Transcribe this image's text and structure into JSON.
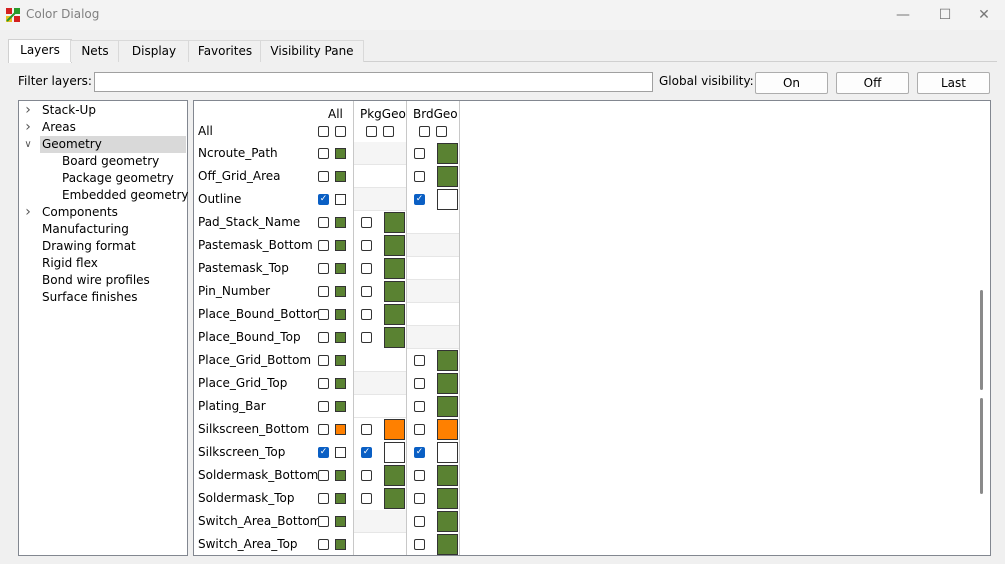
{
  "window": {
    "title": "Color Dialog"
  },
  "tabs": [
    "Layers",
    "Nets",
    "Display",
    "Favorites",
    "Visibility Pane"
  ],
  "filter": {
    "label": "Filter layers:",
    "value": ""
  },
  "global_visibility": {
    "label": "Global visibility:",
    "on": "On",
    "off": "Off",
    "last": "Last"
  },
  "tree": [
    {
      "label": "Stack-Up",
      "level": 0,
      "expander": "collapsed"
    },
    {
      "label": "Areas",
      "level": 0,
      "expander": "collapsed"
    },
    {
      "label": "Geometry",
      "level": 0,
      "expander": "expanded",
      "selected": true
    },
    {
      "label": "Board geometry",
      "level": 1
    },
    {
      "label": "Package geometry",
      "level": 1
    },
    {
      "label": "Embedded geometry",
      "level": 1
    },
    {
      "label": "Components",
      "level": 0,
      "expander": "collapsed"
    },
    {
      "label": "Manufacturing",
      "level": 0
    },
    {
      "label": "Drawing format",
      "level": 0
    },
    {
      "label": "Rigid flex",
      "level": 0
    },
    {
      "label": "Bond wire profiles",
      "level": 0
    },
    {
      "label": "Surface finishes",
      "level": 0
    }
  ],
  "grid": {
    "col_all": "All",
    "col_pkg": "PkgGeo",
    "col_brd": "BrdGeo",
    "row_all": "All",
    "colors": {
      "green": "#5a8232",
      "orange": "#ff8000",
      "white": "#ffffff"
    },
    "rows": [
      {
        "name": "Ncroute_Path",
        "all_on": false,
        "all_color": "green",
        "pkg": null,
        "brd": {
          "on": false,
          "color": "green"
        }
      },
      {
        "name": "Off_Grid_Area",
        "all_on": false,
        "all_color": "green",
        "pkg": null,
        "brd": {
          "on": false,
          "color": "green"
        }
      },
      {
        "name": "Outline",
        "all_on": true,
        "all_color": "white",
        "pkg": null,
        "brd": {
          "on": true,
          "color": "white"
        }
      },
      {
        "name": "Pad_Stack_Name",
        "all_on": false,
        "all_color": "green",
        "pkg": {
          "on": false,
          "color": "green"
        },
        "brd": null
      },
      {
        "name": "Pastemask_Bottom",
        "all_on": false,
        "all_color": "green",
        "pkg": {
          "on": false,
          "color": "green"
        },
        "brd": null
      },
      {
        "name": "Pastemask_Top",
        "all_on": false,
        "all_color": "green",
        "pkg": {
          "on": false,
          "color": "green"
        },
        "brd": null
      },
      {
        "name": "Pin_Number",
        "all_on": false,
        "all_color": "green",
        "pkg": {
          "on": false,
          "color": "green"
        },
        "brd": null
      },
      {
        "name": "Place_Bound_Bottom",
        "all_on": false,
        "all_color": "green",
        "pkg": {
          "on": false,
          "color": "green"
        },
        "brd": null
      },
      {
        "name": "Place_Bound_Top",
        "all_on": false,
        "all_color": "green",
        "pkg": {
          "on": false,
          "color": "green"
        },
        "brd": null
      },
      {
        "name": "Place_Grid_Bottom",
        "all_on": false,
        "all_color": "green",
        "pkg": null,
        "brd": {
          "on": false,
          "color": "green"
        }
      },
      {
        "name": "Place_Grid_Top",
        "all_on": false,
        "all_color": "green",
        "pkg": null,
        "brd": {
          "on": false,
          "color": "green"
        }
      },
      {
        "name": "Plating_Bar",
        "all_on": false,
        "all_color": "green",
        "pkg": null,
        "brd": {
          "on": false,
          "color": "green"
        }
      },
      {
        "name": "Silkscreen_Bottom",
        "all_on": false,
        "all_color": "orange",
        "pkg": {
          "on": false,
          "color": "orange"
        },
        "brd": {
          "on": false,
          "color": "orange"
        }
      },
      {
        "name": "Silkscreen_Top",
        "all_on": true,
        "all_color": "white",
        "pkg": {
          "on": true,
          "color": "white"
        },
        "brd": {
          "on": true,
          "color": "white"
        }
      },
      {
        "name": "Soldermask_Bottom",
        "all_on": false,
        "all_color": "green",
        "pkg": {
          "on": false,
          "color": "green"
        },
        "brd": {
          "on": false,
          "color": "green"
        }
      },
      {
        "name": "Soldermask_Top",
        "all_on": false,
        "all_color": "green",
        "pkg": {
          "on": false,
          "color": "green"
        },
        "brd": {
          "on": false,
          "color": "green"
        }
      },
      {
        "name": "Switch_Area_Bottom",
        "all_on": false,
        "all_color": "green",
        "pkg": null,
        "brd": {
          "on": false,
          "color": "green"
        }
      },
      {
        "name": "Switch_Area_Top",
        "all_on": false,
        "all_color": "green",
        "pkg": null,
        "brd": {
          "on": false,
          "color": "green"
        }
      }
    ]
  }
}
